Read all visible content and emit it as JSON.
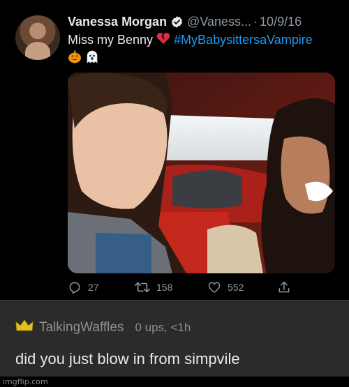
{
  "tweet": {
    "display_name": "Vanessa Morgan",
    "handle": "@Vaness...",
    "separator": "·",
    "date": "10/9/16",
    "text_prefix": "Miss my Benny ",
    "hashtag": "#MyBabysittersaVampire",
    "emoji": [
      "broken-heart",
      "jack-o-lantern",
      "ghost"
    ],
    "actions": {
      "replies": "27",
      "retweets": "158",
      "likes": "552"
    },
    "colors": {
      "link": "#1d9bf0",
      "muted": "#8b98a5",
      "text": "#e7e9ea"
    }
  },
  "comment": {
    "username": "TalkingWaffles",
    "meta": "0 ups, <1h",
    "text": "did you just blow in from simpvile",
    "crown_color": "#e3c01e"
  },
  "watermark": "imgflip.com"
}
